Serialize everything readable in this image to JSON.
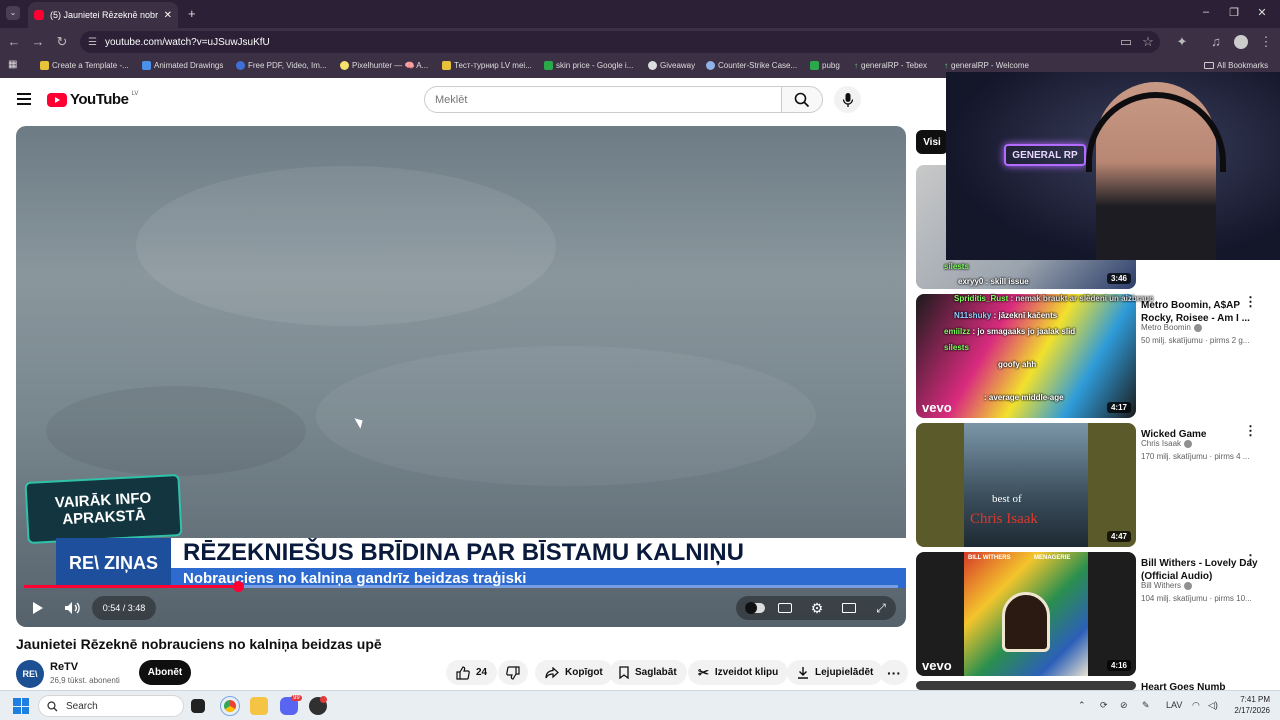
{
  "browser": {
    "tab_title": "(5) Jaunietei Rēzeknē nobraucie",
    "url": "youtube.com/watch?v=uJSuwJsuKfU",
    "bookmarks": [
      "Create a Template -...",
      "Animated Drawings",
      "Free PDF, Video, Im...",
      "Pixelhunter — 🧠 A...",
      "Тест-турнир LV mei...",
      "skin price - Google i...",
      "Giveaway",
      "Counter-Strike Case...",
      "pubg",
      "generalRP - Tebex",
      "generalRP - Welcome"
    ],
    "all_bookmarks": "All Bookmarks"
  },
  "youtube": {
    "logo_text": "YouTube",
    "country_code": "LV",
    "search_placeholder": "Meklēt"
  },
  "video": {
    "info_badge": "VAIRĀK INFO APRAKSTĀ",
    "news_tag": "RE\\ ZIŅAS",
    "headline": "RĒZEKNIEŠUS BRĪDINA PAR BĪSTAMU KALNIŅU",
    "subheadline": "Nobrauciens no kalniņa gandrīz beidzas traģiski",
    "corner_logo": "RE\\LV",
    "time": "0:54 / 3:48",
    "progress": 0.245,
    "title": "Jaunietei Rēzeknē nobrauciens no kalniņa beidzas upē"
  },
  "channel": {
    "avatar": "RE\\",
    "name": "ReTV",
    "subscribers": "26,9 tūkst. abonenti",
    "subscribe_label": "Abonēt"
  },
  "actions": {
    "likes": "24",
    "share": "Kopīgot",
    "save": "Saglabāt",
    "clip": "Izveidot klipu",
    "download": "Lejupielādēt"
  },
  "sidebar": {
    "chip": "Visi",
    "items": [
      {
        "title": "",
        "channel": "",
        "meta": "",
        "duration": "3:46"
      },
      {
        "title": "Metro Boomin, A$AP Rocky, Roisee - Am I ...",
        "channel": "Metro Boomin",
        "meta": "50 milj. skatījumu · pirms 2 g...",
        "duration": "4:17",
        "brand": "vevo"
      },
      {
        "title": "Wicked Game",
        "channel": "Chris Isaak",
        "meta": "170 milj. skatījumu · pirms 4 ...",
        "duration": "4:47",
        "cover_line1": "best of",
        "cover_line2": "Chris Isaak"
      },
      {
        "title": "Bill Withers - Lovely Day (Official Audio)",
        "channel": "Bill Withers",
        "meta": "104 milj. skatījumu · pirms 10...",
        "duration": "4:16",
        "brand": "vevo",
        "cover_line1": "BILL WITHERS",
        "cover_line2": "MENAGERIE"
      },
      {
        "title": "Heart Goes Numb"
      }
    ]
  },
  "webcam": {
    "overlay_text": "GENERAL RP",
    "chat": [
      {
        "user": "silests",
        "text": ""
      },
      {
        "user": "",
        "text": "exryy0 : skill issue"
      },
      {
        "user": "Spriditis_Rust",
        "text": ": nemak braukt ar slēdeni un aizbrauc"
      },
      {
        "user": "N11shuky",
        "text": ": jāzeknī kačents"
      },
      {
        "user": "emiilzz",
        "text": ": jo smagaaks jo jaalak slid"
      },
      {
        "user": "silests",
        "text": ""
      },
      {
        "user": "",
        "text": "goofy ahh"
      },
      {
        "user": "",
        "text": ": average middle-age"
      }
    ]
  },
  "taskbar": {
    "search": "Search",
    "lang": "LAV",
    "time": "7:41 PM",
    "date": "2/17/2026",
    "discord_badge": "99"
  }
}
